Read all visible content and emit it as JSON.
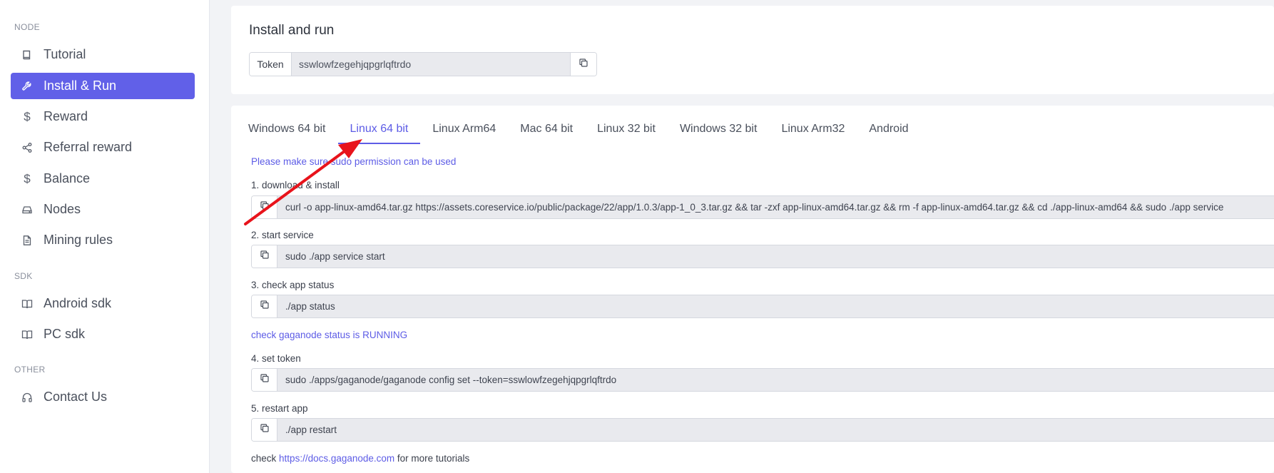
{
  "sidebar": {
    "sections": [
      {
        "title": "NODE"
      },
      {
        "title": "SDK"
      },
      {
        "title": "OTHER"
      }
    ],
    "items": [
      {
        "label": "Tutorial",
        "icon": "book-icon"
      },
      {
        "label": "Install & Run",
        "icon": "wrench-icon",
        "active": true
      },
      {
        "label": "Reward",
        "icon": "dollar-icon"
      },
      {
        "label": "Referral reward",
        "icon": "share-icon"
      },
      {
        "label": "Balance",
        "icon": "dollar-icon"
      },
      {
        "label": "Nodes",
        "icon": "hard-drive-icon"
      },
      {
        "label": "Mining rules",
        "icon": "file-text-icon"
      },
      {
        "label": "Android sdk",
        "icon": "book-open-icon"
      },
      {
        "label": "PC sdk",
        "icon": "book-open-icon"
      },
      {
        "label": "Contact Us",
        "icon": "headphones-icon"
      }
    ]
  },
  "install": {
    "title": "Install and run",
    "token_label": "Token",
    "token_value": "sswlowfzegehjqpgrlqftrdo"
  },
  "tabs": [
    {
      "label": "Windows 64 bit"
    },
    {
      "label": "Linux 64 bit",
      "active": true
    },
    {
      "label": "Linux Arm64"
    },
    {
      "label": "Mac 64 bit"
    },
    {
      "label": "Linux 32 bit"
    },
    {
      "label": "Windows 32 bit"
    },
    {
      "label": "Linux Arm32"
    },
    {
      "label": "Android"
    }
  ],
  "content": {
    "sudo_note": "Please make sure sudo permission can be used",
    "steps": [
      {
        "label": "1. download & install",
        "command": "curl -o app-linux-amd64.tar.gz https://assets.coreservice.io/public/package/22/app/1.0.3/app-1_0_3.tar.gz && tar -zxf app-linux-amd64.tar.gz && rm -f app-linux-amd64.tar.gz && cd ./app-linux-amd64 && sudo ./app service"
      },
      {
        "label": "2. start service",
        "command": "sudo ./app service start"
      },
      {
        "label": "3. check app status",
        "command": "./app status"
      },
      {
        "label": "4. set token",
        "command": "sudo ./apps/gaganode/gaganode config set --token=sswlowfzegehjqpgrlqftrdo"
      },
      {
        "label": "5. restart app",
        "command": "./app restart"
      }
    ],
    "status_note": "check gaganode status is RUNNING",
    "footer_prefix": "check",
    "footer_link": "https://docs.gaganode.com",
    "footer_suffix": "for more tutorials"
  },
  "colors": {
    "accent": "#6160e8",
    "arrow": "#e8131b"
  }
}
